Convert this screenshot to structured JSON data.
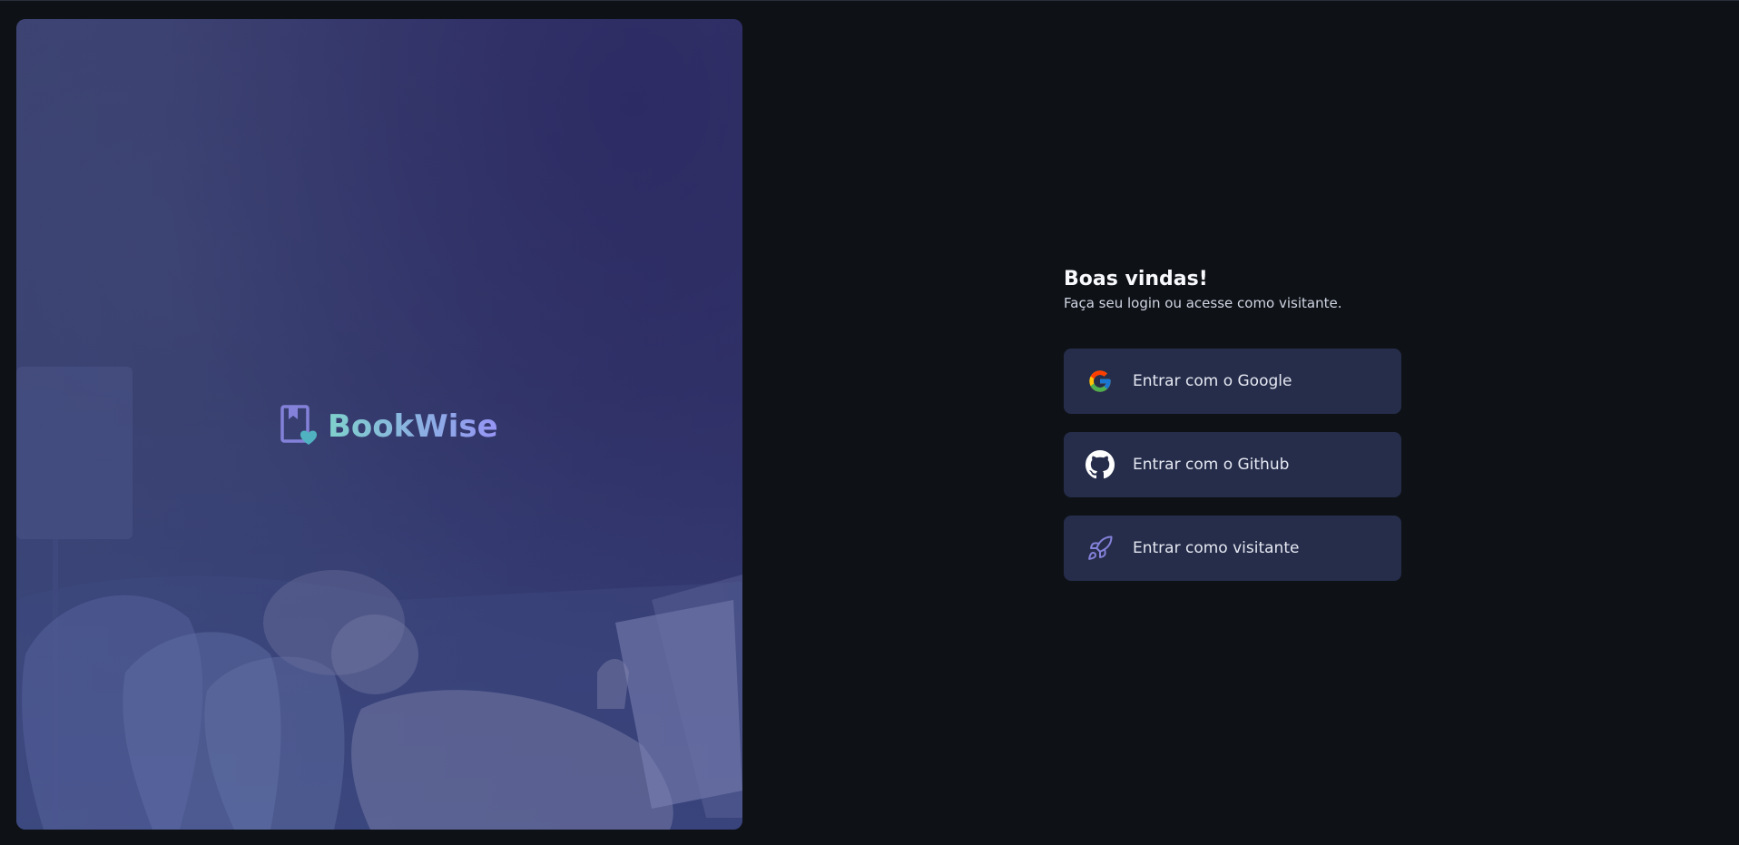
{
  "brand": {
    "name": "BookWise",
    "logo_icon": "book-heart-icon",
    "gradient_start": "#7fd1cc",
    "gradient_end": "#9694f5"
  },
  "hero": {
    "image": "person-reading-on-couch-illustration"
  },
  "login": {
    "title": "Boas vindas!",
    "subtitle": "Faça seu login ou acesse como visitante.",
    "buttons": [
      {
        "label": "Entrar com o Google",
        "icon": "google-icon"
      },
      {
        "label": "Entrar com o Github",
        "icon": "github-icon"
      },
      {
        "label": "Entrar como visitante",
        "icon": "rocket-icon"
      }
    ]
  },
  "colors": {
    "background": "#0e1116",
    "button_bg": "#252d4a",
    "accent": "#8381d9"
  }
}
